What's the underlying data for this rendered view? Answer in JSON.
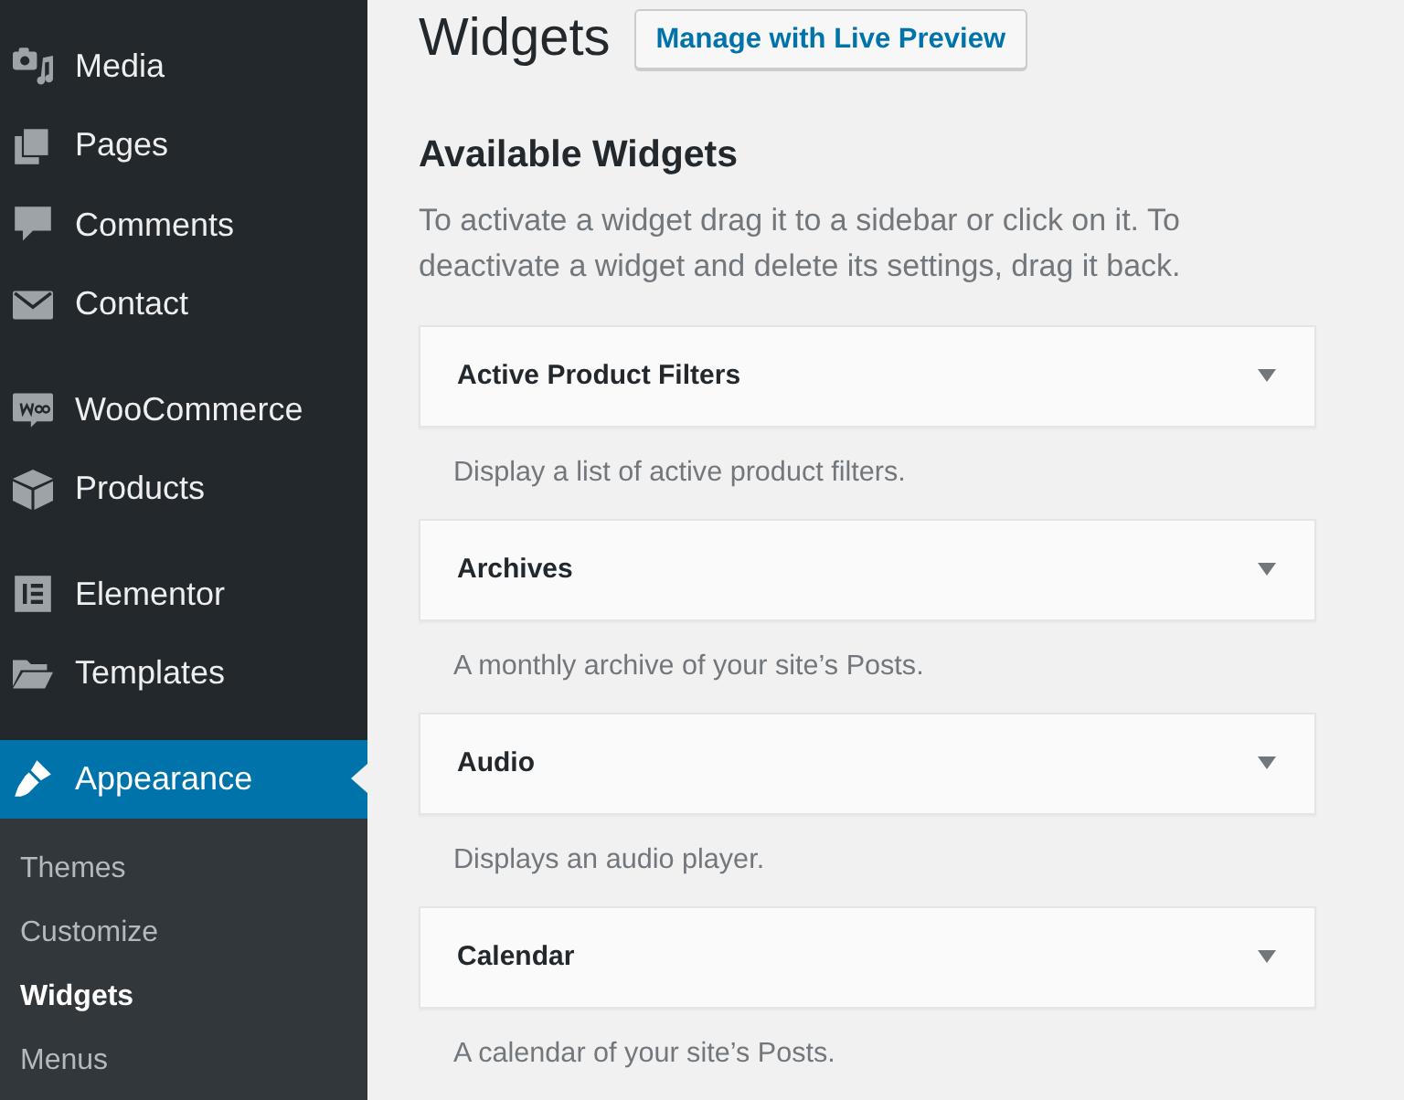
{
  "sidebar": {
    "groups": [
      {
        "items": [
          {
            "label": "Media",
            "selected": false
          },
          {
            "label": "Pages",
            "selected": false
          },
          {
            "label": "Comments",
            "selected": false
          },
          {
            "label": "Contact",
            "selected": false
          }
        ]
      },
      {
        "items": [
          {
            "label": "WooCommerce",
            "selected": false
          },
          {
            "label": "Products",
            "selected": false
          }
        ]
      },
      {
        "items": [
          {
            "label": "Elementor",
            "selected": false
          },
          {
            "label": "Templates",
            "selected": false
          }
        ]
      },
      {
        "items": [
          {
            "label": "Appearance",
            "selected": true,
            "submenu": [
              {
                "label": "Themes",
                "selected": false
              },
              {
                "label": "Customize",
                "selected": false
              },
              {
                "label": "Widgets",
                "selected": true
              },
              {
                "label": "Menus",
                "selected": false
              }
            ]
          }
        ]
      }
    ]
  },
  "page": {
    "title": "Widgets",
    "action_button": "Manage with Live Preview"
  },
  "available_widgets": {
    "heading": "Available Widgets",
    "description": "To activate a widget drag it to a sidebar or click on it. To deactivate a widget and delete its settings, drag it back.",
    "widgets": [
      {
        "title": "Active Product Filters",
        "description": "Display a list of active product filters."
      },
      {
        "title": "Archives",
        "description": "A monthly archive of your site’s Posts."
      },
      {
        "title": "Audio",
        "description": "Displays an audio player."
      },
      {
        "title": "Calendar",
        "description": "A calendar of your site’s Posts."
      }
    ]
  }
}
